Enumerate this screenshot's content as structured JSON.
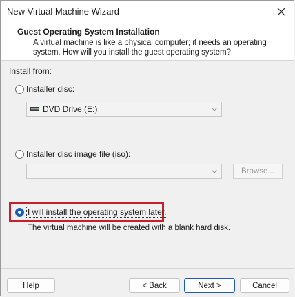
{
  "window": {
    "title": "New Virtual Machine Wizard"
  },
  "header": {
    "title": "Guest Operating System Installation",
    "description": "A virtual machine is like a physical computer; it needs an operating system. How will you install the guest operating system?"
  },
  "install_from": {
    "label": "Install from:",
    "options": [
      {
        "label": "Installer disc:",
        "selected": false
      },
      {
        "label": "Installer disc image file (iso):",
        "selected": false
      },
      {
        "label": "I will install the operating system later.",
        "selected": true
      }
    ],
    "disc_dropdown": {
      "value": "DVD Drive (E:)"
    },
    "iso_dropdown": {
      "value": ""
    },
    "browse_label": "Browse...",
    "note": "The virtual machine will be created with a blank hard disk."
  },
  "buttons": {
    "help": "Help",
    "back": "< Back",
    "next": "Next >",
    "cancel": "Cancel"
  },
  "icons": {
    "close": "close-icon",
    "dvd": "dvd-drive-icon",
    "chevron": "chevron-down-icon"
  }
}
